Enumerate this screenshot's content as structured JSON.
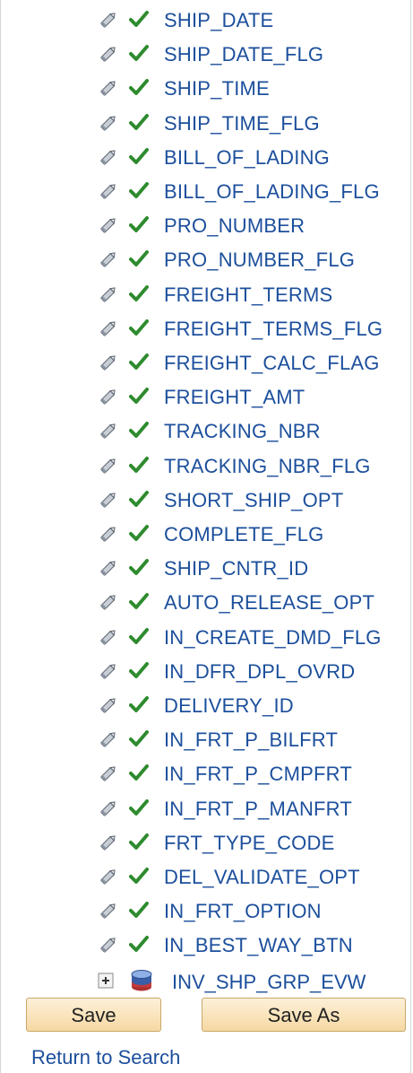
{
  "fields": [
    "SHIP_DATE",
    "SHIP_DATE_FLG",
    "SHIP_TIME",
    "SHIP_TIME_FLG",
    "BILL_OF_LADING",
    "BILL_OF_LADING_FLG",
    "PRO_NUMBER",
    "PRO_NUMBER_FLG",
    "FREIGHT_TERMS",
    "FREIGHT_TERMS_FLG",
    "FREIGHT_CALC_FLAG",
    "FREIGHT_AMT",
    "TRACKING_NBR",
    "TRACKING_NBR_FLG",
    "SHORT_SHIP_OPT",
    "COMPLETE_FLG",
    "SHIP_CNTR_ID",
    "AUTO_RELEASE_OPT",
    "IN_CREATE_DMD_FLG",
    "IN_DFR_DPL_OVRD",
    "DELIVERY_ID",
    "IN_FRT_P_BILFRT",
    "IN_FRT_P_CMPFRT",
    "IN_FRT_P_MANFRT",
    "FRT_TYPE_CODE",
    "DEL_VALIDATE_OPT",
    "IN_FRT_OPTION",
    "IN_BEST_WAY_BTN"
  ],
  "field_icons": {
    "edit": "pencil-icon",
    "status": "check-icon"
  },
  "group": {
    "label": "INV_SHP_GRP_EVW",
    "expand_icon": "expand-plus-icon",
    "record_icon": "database-icon"
  },
  "buttons": {
    "save": "Save",
    "save_as": "Save As"
  },
  "links": {
    "return_to_search": "Return to Search"
  },
  "colors": {
    "link": "#1c4f9c",
    "check": "#2e8b2e",
    "button": "#f6d9a3"
  }
}
